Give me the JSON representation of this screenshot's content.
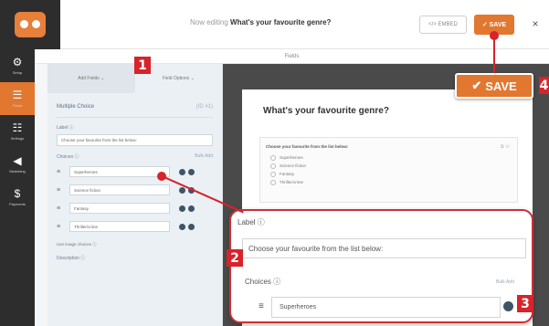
{
  "header": {
    "now_editing_prefix": "Now editing",
    "form_title": "What's your favourite genre?",
    "embed_label": "</> EMBED",
    "save_label": "✓ SAVE",
    "close_label": "×"
  },
  "sidebar": {
    "items": [
      {
        "label": "Setup",
        "icon": "gear-icon"
      },
      {
        "label": "Fields",
        "icon": "fields-icon",
        "active": true
      },
      {
        "label": "Settings",
        "icon": "sliders-icon"
      },
      {
        "label": "Marketing",
        "icon": "megaphone-icon"
      },
      {
        "label": "Payments",
        "icon": "dollar-icon"
      }
    ]
  },
  "panel": {
    "title": "Fields",
    "tabs": [
      "Add Fields ⌄",
      "Field Options ⌄"
    ],
    "field_type": "Multiple Choice",
    "field_id": "(ID #1)",
    "label_caption": "Label ⓘ",
    "label_value": "Choose your favourite from the list below:",
    "choices_caption": "Choices ⓘ",
    "bulk_add": "Bulk Add",
    "choices": [
      "Superheroes",
      "Science fiction",
      "Fantasy",
      "Thriller/crime"
    ],
    "use_images": "Use image choices ⓘ",
    "description_caption": "Description ⓘ"
  },
  "preview": {
    "title": "What's your favourite genre?",
    "question": "Choose your favourite from the list below:",
    "options": [
      "Superheroes",
      "Science fiction",
      "Fantasy",
      "Thriller/crime"
    ]
  },
  "callout": {
    "label_caption": "Label ⓘ",
    "label_value": "Choose your favourite from the list below:",
    "choices_caption": "Choices ⓘ",
    "bulk_add": "Bulk Add",
    "choice_value": "Superheroes"
  },
  "save_callout": {
    "check": "✔",
    "label": "SAVE"
  },
  "markers": [
    "1",
    "2",
    "3",
    "4"
  ],
  "colors": {
    "accent": "#e27730",
    "marker": "#d8232a",
    "nav_bg": "#2d2d2d"
  }
}
